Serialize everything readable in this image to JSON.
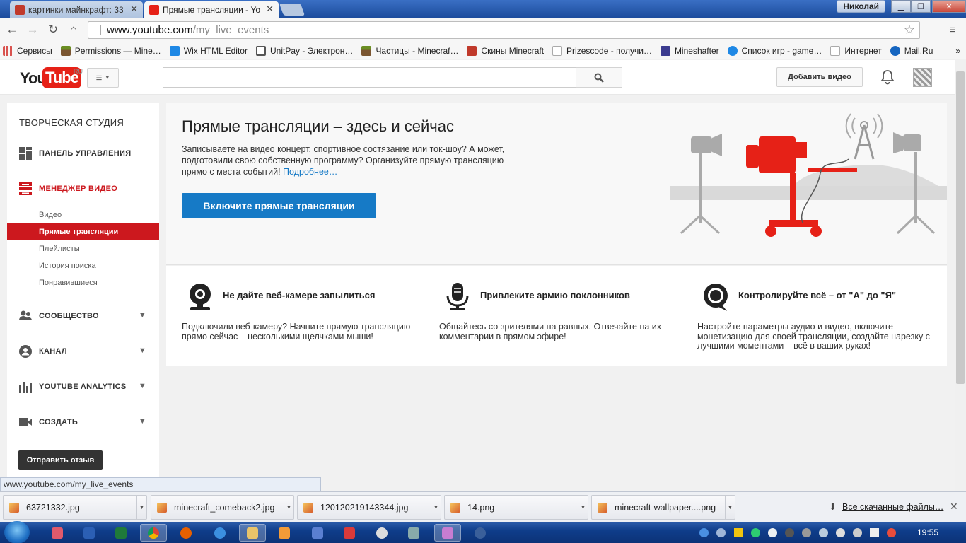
{
  "browser": {
    "tabs": [
      {
        "title": "картинки майнкрафт: 33",
        "active": false
      },
      {
        "title": "Прямые трансляции - Yo",
        "active": true
      }
    ],
    "user": "Николай",
    "url_host": "www.youtube.com",
    "url_path": "/my_live_events",
    "bookmarks": [
      {
        "label": "Сервисы",
        "icon": "apps-icon",
        "color": "#d9534f"
      },
      {
        "label": "Permissions — Mine…",
        "icon": "grass-block-icon",
        "color": "#6b8e23"
      },
      {
        "label": "Wix HTML Editor",
        "icon": "wix-icon",
        "color": "#1e88e5"
      },
      {
        "label": "UnitPay - Электрон…",
        "icon": "unitpay-icon",
        "color": "#555555"
      },
      {
        "label": "Частицы - Minecraf…",
        "icon": "grass-block-icon",
        "color": "#6b8e23"
      },
      {
        "label": "Скины Minecraft",
        "icon": "skin-icon",
        "color": "#c0392b"
      },
      {
        "label": "Prizescode - получи…",
        "icon": "page-icon",
        "color": "#bbbbbb"
      },
      {
        "label": "Mineshafter",
        "icon": "mineshafter-icon",
        "color": "#3b3b8f"
      },
      {
        "label": "Список игр - game…",
        "icon": "globe-icon",
        "color": "#1e88e5"
      },
      {
        "label": "Интернет",
        "icon": "page-icon",
        "color": "#bbbbbb"
      },
      {
        "label": "Mail.Ru",
        "icon": "mailru-icon",
        "color": "#1565c0"
      }
    ]
  },
  "youtube": {
    "logo_you": "You",
    "logo_tube": "Tube",
    "logo_region": "RU",
    "search_placeholder": "",
    "upload_label": "Добавить видео"
  },
  "sidebar": {
    "title": "ТВОРЧЕСКАЯ СТУДИЯ",
    "dashboard": "ПАНЕЛЬ УПРАВЛЕНИЯ",
    "video_manager": "МЕНЕДЖЕР ВИДЕО",
    "sub_items": [
      {
        "label": "Видео",
        "selected": false
      },
      {
        "label": "Прямые трансляции",
        "selected": true
      },
      {
        "label": "Плейлисты",
        "selected": false
      },
      {
        "label": "История поиска",
        "selected": false
      },
      {
        "label": "Понравившиеся",
        "selected": false
      }
    ],
    "community": "СООБЩЕСТВО",
    "channel": "КАНАЛ",
    "analytics": "YOUTUBE ANALYTICS",
    "create": "СОЗДАТЬ",
    "feedback": "Отправить отзыв"
  },
  "hero": {
    "title": "Прямые трансляции – здесь и сейчас",
    "desc": "Записываете на видео концерт, спортивное состязание или ток-шоу? А может, подготовили свою собственную программу? Организуйте прямую трансляцию прямо с места событий!",
    "more_link": "Подробнее…",
    "button": "Включите прямые трансляции"
  },
  "features": [
    {
      "icon": "webcam-icon",
      "title": "Не дайте веб-камере запылиться",
      "desc": "Подключили веб-камеру? Начните прямую трансляцию прямо сейчас – несколькими щелчками мыши!"
    },
    {
      "icon": "microphone-icon",
      "title": "Привлеките армию поклонников",
      "desc": "Общайтесь со зрителями на равных. Отвечайте на их комментарии в прямом эфире!"
    },
    {
      "icon": "control-icon",
      "title": "Контролируйте всё – от \"А\" до \"Я\"",
      "desc": "Настройте параметры аудио и видео, включите монетизацию для своей трансляции, создайте нарезку с лучшими моментами – всё в ваших руках!"
    }
  ],
  "status_url": "www.youtube.com/my_live_events",
  "downloads": {
    "items": [
      "63721332.jpg",
      "minecraft_comeback2.jpg",
      "120120219143344.jpg",
      "14.png",
      "minecraft-wallpaper....png"
    ],
    "all_label": "Все скачанные файлы…"
  },
  "taskbar": {
    "time": "19:55"
  },
  "colors": {
    "yt_red": "#e62117",
    "selected_nav": "#cc181e",
    "primary_button": "#167ac6"
  }
}
